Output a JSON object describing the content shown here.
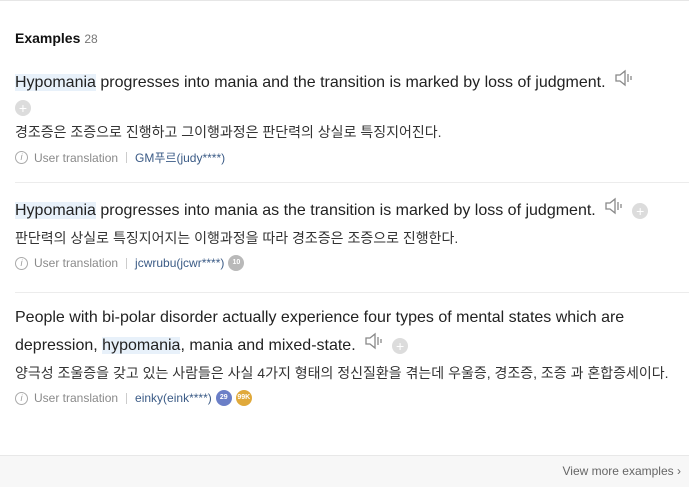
{
  "header": {
    "title": "Examples",
    "count": "28"
  },
  "examples": [
    {
      "en_highlight": "Hypomania",
      "en_rest": " progresses into mania and the transition is marked by loss of judgment.",
      "ko": "경조증은 조증으로 진행하고 그이행과정은 판단력의 상실로 특징지어진다.",
      "meta_label": "User translation",
      "user": "GM푸르(judy****)"
    },
    {
      "en_highlight": "Hypomania",
      "en_rest": " progresses into mania as the transition is marked by loss of judgment.",
      "ko": "판단력의 상실로 특징지어지는 이행과정을 따라 경조증은 조증으로 진행한다.",
      "meta_label": "User translation",
      "user": "jcwrubu(jcwr****)",
      "badge": "10"
    },
    {
      "en_before": "People with bi-polar disorder actually experience four types of mental states which are depression, ",
      "en_highlight": "hypomania",
      "en_after": ", mania and mixed-state.",
      "ko": "양극성 조울증을 갖고 있는 사람들은 사실 4가지 형태의 정신질환을 겪는데 우울증, 경조증, 조증 과 혼합증세이다.",
      "meta_label": "User translation",
      "user": "einky(eink****)",
      "badge1": "29 18",
      "badge2": "99K"
    }
  ],
  "footer": {
    "more_label": "View more examples"
  },
  "colors": {
    "highlight": "#e8f1fa",
    "user_link": "#3b5b86"
  },
  "icons": [
    "info-icon",
    "speaker-icon",
    "add-icon",
    "chevron-right-icon"
  ]
}
